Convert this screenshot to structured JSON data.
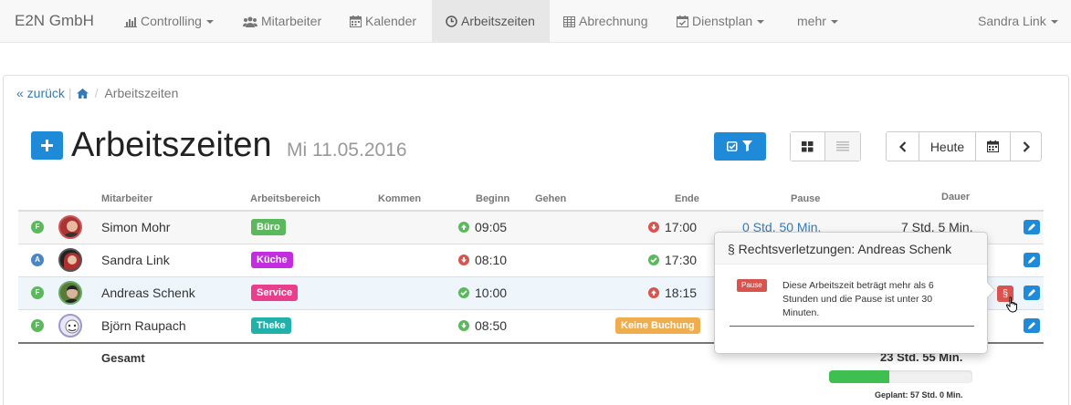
{
  "nav": {
    "brand": "E2N GmbH",
    "items": [
      {
        "label": "Controlling",
        "icon": "bar-chart-icon",
        "dropdown": true
      },
      {
        "label": "Mitarbeiter",
        "icon": "users-icon"
      },
      {
        "label": "Kalender",
        "icon": "calendar-icon"
      },
      {
        "label": "Arbeitszeiten",
        "icon": "clock-icon",
        "active": true
      },
      {
        "label": "Abrechnung",
        "icon": "table-icon"
      },
      {
        "label": "Dienstplan",
        "icon": "calendar-check-icon",
        "dropdown": true
      },
      {
        "label": "mehr",
        "dropdown": true
      }
    ],
    "user": "Sandra Link"
  },
  "breadcrumb": {
    "back": "« zurück",
    "current": "Arbeitszeiten"
  },
  "header": {
    "title": "Arbeitszeiten",
    "date": "Mi 11.05.2016"
  },
  "toolbar": {
    "today": "Heute"
  },
  "columns": [
    "Mitarbeiter",
    "Arbeitsbereich",
    "Kommen",
    "Beginn",
    "Gehen",
    "Ende",
    "Pause",
    "Dauer"
  ],
  "rows": [
    {
      "status": "F",
      "status_color": "#5cb85c",
      "name": "Simon Mohr",
      "area": "Büro",
      "area_color": "#5cb85c",
      "begin": "09:05",
      "begin_icon": "arrow-up",
      "end": "17:00",
      "end_icon": "arrow-down",
      "pause": "0 Std. 50 Min.",
      "duration": "7 Std. 5 Min."
    },
    {
      "status": "A",
      "status_color": "#4a86c5",
      "name": "Sandra Link",
      "area": "Küche",
      "area_color": "#c32de0",
      "begin": "08:10",
      "begin_icon": "arrow-down",
      "end": "17:30",
      "end_icon": "check"
    },
    {
      "status": "F",
      "status_color": "#5cb85c",
      "name": "Andreas Schenk",
      "area": "Service",
      "area_color": "#e83e8c",
      "begin": "10:00",
      "begin_icon": "check",
      "end": "18:15",
      "end_icon": "arrow-up"
    },
    {
      "status": "F",
      "status_color": "#5cb85c",
      "name": "Björn Raupach",
      "area": "Theke",
      "area_color": "#20b2aa",
      "begin": "08:50",
      "begin_icon": "arrow-down",
      "end_badge": "Keine Buchung"
    }
  ],
  "total": {
    "label": "Gesamt",
    "duration": "23 Std. 55 Min.",
    "progress": 0.42,
    "planned": "Geplant: 57 Std. 0 Min."
  },
  "popover": {
    "title": "§ Rechtsverletzungen: Andreas Schenk",
    "label": "Pause",
    "text": "Diese Arbeitszeit beträgt mehr als 6 Stunden und die Pause ist unter 30 Minuten."
  },
  "violation_symbol": "§"
}
